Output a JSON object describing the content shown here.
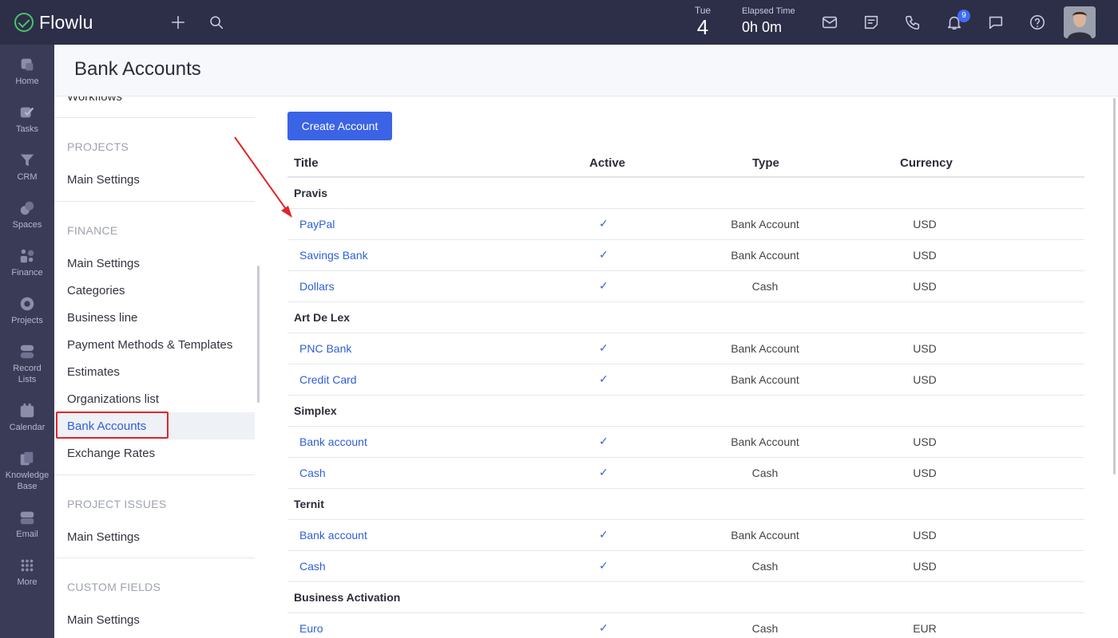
{
  "app": {
    "name": "Flowlu"
  },
  "topbar": {
    "day": "Tue",
    "date": "4",
    "elapsed_label": "Elapsed Time",
    "elapsed_value": "0h 0m",
    "notification_count": "9"
  },
  "leftnav": {
    "items": [
      {
        "label": "Home",
        "icon": "home-icon"
      },
      {
        "label": "Tasks",
        "icon": "tasks-icon"
      },
      {
        "label": "CRM",
        "icon": "crm-icon"
      },
      {
        "label": "Spaces",
        "icon": "spaces-icon"
      },
      {
        "label": "Finance",
        "icon": "finance-icon"
      },
      {
        "label": "Projects",
        "icon": "projects-icon"
      },
      {
        "label": "Record Lists",
        "icon": "record-lists-icon"
      },
      {
        "label": "Calendar",
        "icon": "calendar-icon"
      },
      {
        "label": "Knowledge Base",
        "icon": "knowledge-base-icon"
      },
      {
        "label": "Email",
        "icon": "email-icon"
      },
      {
        "label": "More",
        "icon": "more-icon"
      }
    ]
  },
  "page": {
    "title": "Bank Accounts"
  },
  "settings": {
    "clipped_item": "Workflows",
    "sections": [
      {
        "title": "PROJECTS",
        "items": [
          "Main Settings"
        ]
      },
      {
        "title": "FINANCE",
        "items": [
          "Main Settings",
          "Categories",
          "Business line",
          "Payment Methods & Templates",
          "Estimates",
          "Organizations list",
          "Bank Accounts",
          "Exchange Rates"
        ]
      },
      {
        "title": "PROJECT ISSUES",
        "items": [
          "Main Settings"
        ]
      },
      {
        "title": "CUSTOM FIELDS",
        "items": [
          "Main Settings"
        ]
      }
    ],
    "active_item": "Bank Accounts"
  },
  "main": {
    "create_button": "Create Account",
    "columns": [
      "Title",
      "Active",
      "Type",
      "Currency"
    ],
    "groups": [
      {
        "name": "Pravis",
        "accounts": [
          {
            "title": "PayPal",
            "active": "✓",
            "type": "Bank Account",
            "currency": "USD"
          },
          {
            "title": "Savings Bank",
            "active": "✓",
            "type": "Bank Account",
            "currency": "USD"
          },
          {
            "title": "Dollars",
            "active": "✓",
            "type": "Cash",
            "currency": "USD"
          }
        ]
      },
      {
        "name": "Art De Lex",
        "accounts": [
          {
            "title": "PNC Bank",
            "active": "✓",
            "type": "Bank Account",
            "currency": "USD"
          },
          {
            "title": "Credit Card",
            "active": "✓",
            "type": "Bank Account",
            "currency": "USD"
          }
        ]
      },
      {
        "name": "Simplex",
        "accounts": [
          {
            "title": "Bank account",
            "active": "✓",
            "type": "Bank Account",
            "currency": "USD"
          },
          {
            "title": "Cash",
            "active": "✓",
            "type": "Cash",
            "currency": "USD"
          }
        ]
      },
      {
        "name": "Ternit",
        "accounts": [
          {
            "title": "Bank account",
            "active": "✓",
            "type": "Bank Account",
            "currency": "USD"
          },
          {
            "title": "Cash",
            "active": "✓",
            "type": "Cash",
            "currency": "USD"
          }
        ]
      },
      {
        "name": "Business Activation",
        "accounts": [
          {
            "title": "Euro",
            "active": "✓",
            "type": "Cash",
            "currency": "EUR"
          }
        ]
      }
    ]
  },
  "colors": {
    "topbar_bg": "#2d2e48",
    "leftnav_bg": "#3a3b57",
    "accent_blue": "#3b63e6",
    "link_blue": "#2f5fd6",
    "annotation_red": "#e0262a",
    "logo_green": "#4cc36b"
  }
}
